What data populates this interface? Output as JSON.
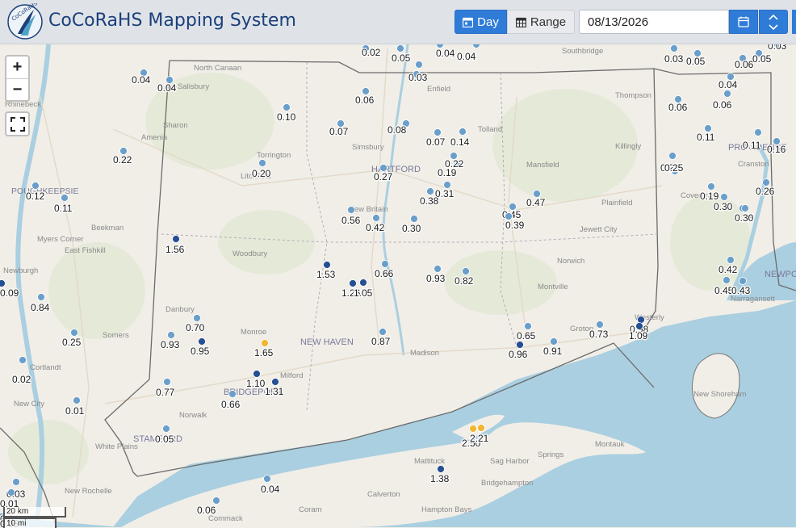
{
  "header": {
    "title": "CoCoRaHS Mapping System",
    "logo_text": "CoCoRaHS",
    "day_label": "Day",
    "range_label": "Range",
    "date_value": "08/13/2026"
  },
  "colors": {
    "header_bg": "#dfe3e8",
    "title": "#1b3f7a",
    "accent": "#2f7bd8",
    "water": "#aacfe0",
    "land": "#f1eee8",
    "marker_light": "#6a9fcb",
    "marker_dark": "#264f94",
    "marker_high": "#f2b632"
  },
  "controls": {
    "zoom_in": "+",
    "zoom_out": "−",
    "fullscreen_icon": "fullscreen-icon",
    "scale_km": "20 km",
    "scale_mi": "10 mi"
  },
  "place_labels": [
    "North Canaan",
    "Salisbury",
    "Rhinebeck",
    "Sharon",
    "Amenia",
    "Torrington",
    "Litchfield",
    "Simsbury",
    "HARTFORD",
    "Enfield",
    "Tolland",
    "Mansfield",
    "Killingly",
    "Thompson",
    "Southbridge",
    "Plainfield",
    "Coventry",
    "PROVIDENCE",
    "Cranston",
    "POUGHKEEPSIE",
    "Beekman",
    "Myers Corner",
    "East Fishkill",
    "Newburgh",
    "Woodbury",
    "New Britain",
    "Jewett City",
    "Norwich",
    "Montville",
    "Danbury",
    "Somers",
    "Monroe",
    "NEW HAVEN",
    "Madison",
    "Groton",
    "Westerly",
    "Milford",
    "BRIDGEPORT",
    "Cortlandt",
    "New City",
    "Norwalk",
    "STAMFORD",
    "White Plains",
    "New Rochelle",
    "Mattituck",
    "Sag Harbor",
    "Springs",
    "Montauk",
    "Bridgehampton",
    "Calverton",
    "Hampton Bays",
    "Coram",
    "Commack",
    "New Shoreham",
    "NEWPORT",
    "Narragansett"
  ],
  "precip_readings": [
    "0.02",
    "0.05",
    "0.04",
    "0.04",
    "0.03",
    "0.04",
    "0.04",
    "0.04",
    "0.03",
    "0.05",
    "0.03",
    "0.06",
    "0.05",
    "0.04",
    "0.06",
    "0.06",
    "0.06",
    "0.10",
    "0.07",
    "0.08",
    "0.07",
    "0.14",
    "0.11",
    "0.11",
    "0.16",
    "0.22",
    "0.20",
    "0.27",
    "0.19",
    "0.22",
    "0.25",
    "0.25",
    "0.31",
    "0.38",
    "0.47",
    "0.45",
    "0.39",
    "0.12",
    "0.11",
    "0.56",
    "0.42",
    "0.30",
    "0.19",
    "0.30",
    "0.25",
    "0.26",
    "0.30",
    "0.42",
    "0.45",
    "0.43",
    "1.56",
    "1.53",
    "1.26",
    "1.05",
    "0.66",
    "0.93",
    "0.82",
    "0.84",
    "0.09",
    "0.70",
    "0.93",
    "0.95",
    "0.25",
    "1.65",
    "0.87",
    "0.65",
    "0.96",
    "0.91",
    "0.73",
    "0.98",
    "1.09",
    "0.02",
    "0.77",
    "1.10",
    "1.31",
    "0.66",
    "0.01",
    "0.05",
    "2.50",
    "2.21",
    "1.38",
    "0.04",
    "0.06",
    "0.03",
    "0.01",
    "0.04",
    "0.05"
  ]
}
